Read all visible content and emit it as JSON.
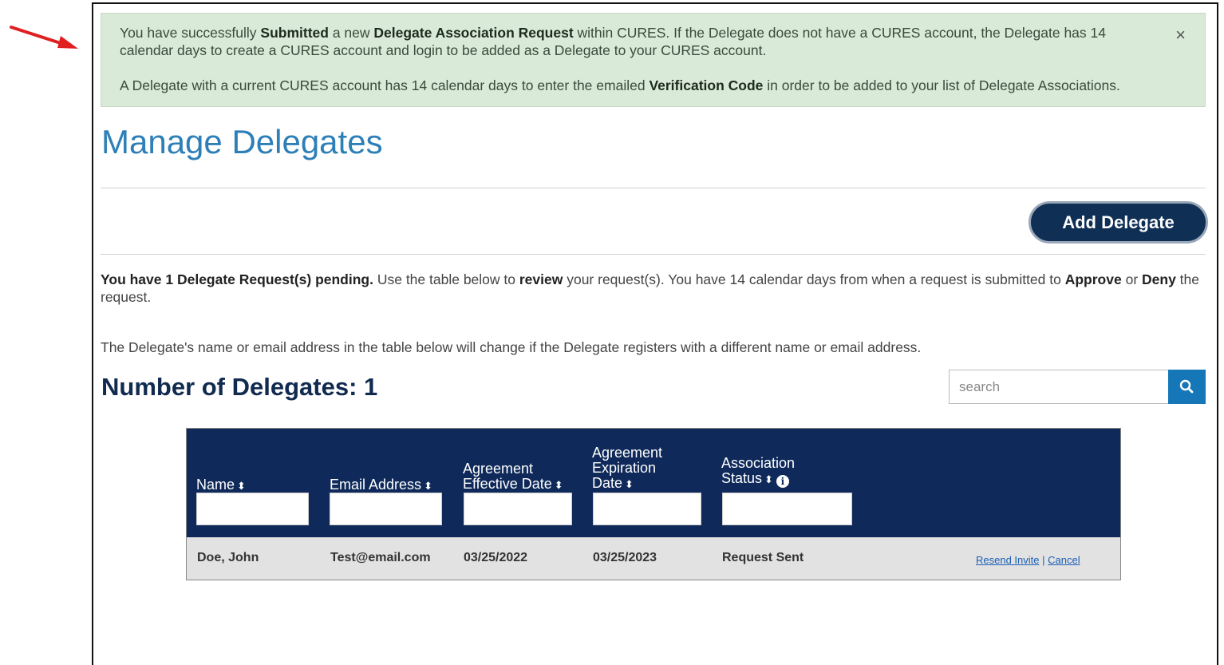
{
  "alert": {
    "line1_a": "You have successfully ",
    "line1_b": "Submitted",
    "line1_c": " a new ",
    "line1_d": "Delegate Association Request",
    "line1_e": " within CURES. If the Delegate does not have a CURES account, the Delegate has 14 calendar days to create a CURES account and login to be added as a Delegate to your CURES account.",
    "line2_a": "A Delegate with a current CURES account has 14 calendar days to enter the emailed ",
    "line2_b": "Verification Code",
    "line2_c": " in order to be added to your list of Delegate Associations.",
    "close": "×"
  },
  "page": {
    "title": "Manage Delegates",
    "add_button": "Add Delegate",
    "notice_a": "You have 1 Delegate Request(s) pending.",
    "notice_b": " Use the table below to ",
    "notice_c": "review",
    "notice_d": " your request(s). You have 14 calendar days from when a request is submitted to ",
    "notice_e": "Approve",
    "notice_f": " or ",
    "notice_g": "Deny",
    "notice_h": " the request.",
    "note2": "The Delegate's name or email address in the table below will change if the Delegate registers with a different name or email address.",
    "count_label": "Number of Delegates: 1"
  },
  "search": {
    "placeholder": "search",
    "value": ""
  },
  "table": {
    "headers": [
      {
        "l1": "",
        "l2": "",
        "l3": "Name",
        "sort": "⬍"
      },
      {
        "l1": "",
        "l2": "",
        "l3": "Email Address",
        "sort": "⬍"
      },
      {
        "l1": "",
        "l2": "Agreement",
        "l3": "Effective Date",
        "sort": "⬍"
      },
      {
        "l1": "Agreement",
        "l2": "Expiration",
        "l3": "Date",
        "sort": "⬍"
      },
      {
        "l1": "",
        "l2": "Association",
        "l3": "Status",
        "sort": "⬍",
        "info": "i"
      }
    ],
    "rows": [
      {
        "name": "Doe, John",
        "email": "Test@email.com",
        "effective": "03/25/2022",
        "expiration": "03/25/2023",
        "status": "Request Sent",
        "action_resend": "Resend Invite",
        "action_sep": " | ",
        "action_cancel": "Cancel"
      }
    ]
  },
  "colors": {
    "accent_title": "#2d7fb8",
    "header_navy": "#0f2a5a",
    "alert_bg": "#d9ead8",
    "arrow_red": "#e02020"
  }
}
